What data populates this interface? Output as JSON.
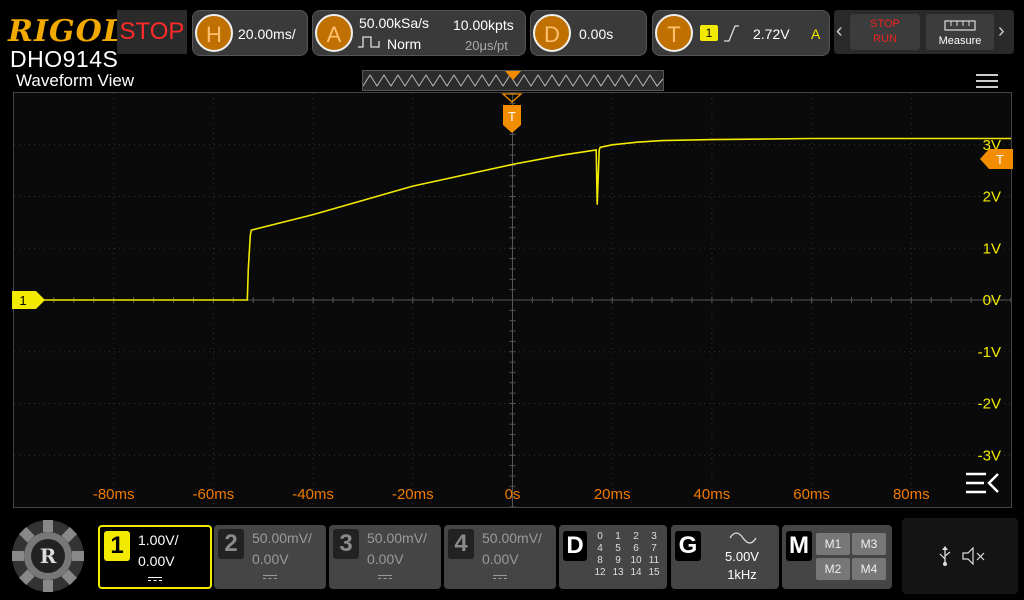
{
  "brand": "RIGOL",
  "model": "DHO914S",
  "run_state": "STOP",
  "horizontal": {
    "letter": "H",
    "timebase": "20.00ms/"
  },
  "acquire": {
    "letter": "A",
    "sample_rate": "50.00kSa/s",
    "mode": "Norm",
    "mem_depth": "10.00kpts",
    "time_per_pt": "20μs/pt"
  },
  "delay": {
    "letter": "D",
    "value": "0.00s"
  },
  "trigger": {
    "letter": "T",
    "source": "1",
    "level": "2.72V",
    "mode_flag": "A"
  },
  "buttons": {
    "stop_run_top": "STOP",
    "stop_run_bottom": "RUN",
    "measure": "Measure"
  },
  "view_title": "Waveform View",
  "markers": {
    "trigger": "T",
    "channel1": "1",
    "trig_level": "T"
  },
  "y_labels": [
    "3V",
    "2V",
    "1V",
    "0V",
    "-1V",
    "-2V",
    "-3V"
  ],
  "x_labels": [
    "-80ms",
    "-60ms",
    "-40ms",
    "-20ms",
    "0s",
    "20ms",
    "40ms",
    "60ms",
    "80ms"
  ],
  "channels": [
    {
      "num": "1",
      "scale": "1.00V/",
      "offset": "0.00V",
      "active": true
    },
    {
      "num": "2",
      "scale": "50.00mV/",
      "offset": "0.00V",
      "active": false
    },
    {
      "num": "3",
      "scale": "50.00mV/",
      "offset": "0.00V",
      "active": false
    },
    {
      "num": "4",
      "scale": "50.00mV/",
      "offset": "0.00V",
      "active": false
    }
  ],
  "digital": {
    "letter": "D",
    "rows": [
      [
        "0",
        "1",
        "2",
        "3"
      ],
      [
        "4",
        "5",
        "6",
        "7"
      ],
      [
        "8",
        "9",
        "10",
        "11"
      ],
      [
        "12",
        "13",
        "14",
        "15"
      ]
    ]
  },
  "generator": {
    "letter": "G",
    "amplitude": "5.00V",
    "frequency": "1kHz"
  },
  "math": {
    "letter": "M",
    "items": [
      "M1",
      "M3",
      "M2",
      "M4"
    ]
  },
  "colors": {
    "accent": "#f28c00",
    "ch1": "#f2ea00",
    "label_orange": "#f07a00"
  },
  "chart_data": {
    "type": "line",
    "xlabel": "",
    "ylabel": "",
    "xlim": [
      -100,
      100
    ],
    "ylim": [
      -4,
      4
    ],
    "x_unit": "ms",
    "y_unit": "V",
    "series": [
      {
        "x": [
          -100,
          -53.2,
          -53,
          -52.6,
          -52.4,
          -40,
          -20,
          0,
          10,
          16.8,
          17,
          17.4,
          17.6,
          20,
          25,
          30,
          40,
          60,
          80,
          100
        ],
        "y": [
          0,
          0,
          0.6,
          1.25,
          1.35,
          1.65,
          2.2,
          2.62,
          2.8,
          2.9,
          1.85,
          2.9,
          2.95,
          3.0,
          3.05,
          3.08,
          3.1,
          3.12,
          3.12,
          3.12
        ]
      }
    ]
  }
}
